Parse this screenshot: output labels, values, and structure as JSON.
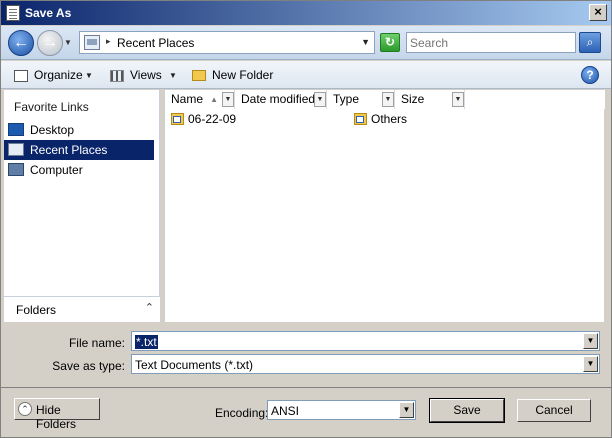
{
  "window": {
    "title": "Save As",
    "close_glyph": "×"
  },
  "address_bar": {
    "back_glyph": "←",
    "forward_glyph": "→",
    "history_glyph": "▼",
    "breadcrumb_sep": "▸",
    "current_location": "Recent Places",
    "dropdown_glyph": "▼",
    "refresh_glyph": "↻",
    "search_placeholder": "Search",
    "search_glyph": "⌕"
  },
  "toolbar": {
    "organize_label": "Organize",
    "views_label": "Views",
    "new_folder_label": "New Folder",
    "caret_glyph": "▼",
    "help_glyph": "?"
  },
  "nav_pane": {
    "title": "Favorite Links",
    "items": [
      {
        "label": "Desktop",
        "icon": "desktop-icon"
      },
      {
        "label": "Recent Places",
        "icon": "recent-places-icon"
      },
      {
        "label": "Computer",
        "icon": "computer-icon"
      }
    ],
    "folders_label": "Folders",
    "folders_chevron": "⌃"
  },
  "file_list": {
    "columns": [
      "Name",
      "Date modified",
      "Type",
      "Size"
    ],
    "sort_glyph": "▲",
    "col_drop_glyph": "▼",
    "items": [
      {
        "name": "06-22-09"
      },
      {
        "name": "Others"
      }
    ]
  },
  "form": {
    "file_name_label": "File name:",
    "file_name_value": "*.txt",
    "save_as_type_label": "Save as type:",
    "save_as_type_value": "Text Documents (*.txt)",
    "combo_arrow": "▼"
  },
  "footer": {
    "hide_folders_label": "Hide Folders",
    "hide_folders_chevron": "⌃",
    "encoding_label": "Encoding:",
    "encoding_value": "ANSI",
    "save_label": "Save",
    "cancel_label": "Cancel"
  },
  "colors": {
    "title_bar": "#0a246a",
    "selection": "#0a246a",
    "dialog_face": "#d4d0c8"
  }
}
